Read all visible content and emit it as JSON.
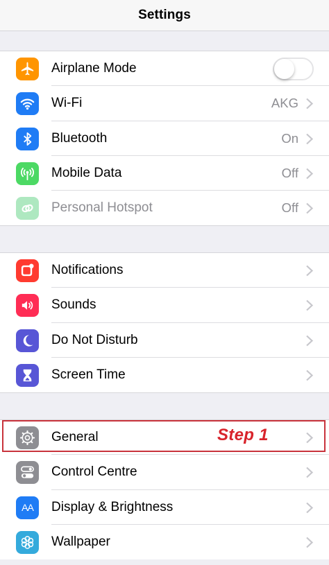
{
  "nav": {
    "title": "Settings"
  },
  "colors": {
    "orange": "#ff9500",
    "blue": "#1f7cf5",
    "green": "#4cd964",
    "green_light": "#aee8c0",
    "red": "#ff3b30",
    "pink": "#ff2d55",
    "purple": "#5856d6",
    "gray": "#8e8e93",
    "annotation": "#d8242c"
  },
  "group1": [
    {
      "label": "Airplane Mode",
      "icon": "airplane-icon",
      "toggle": "off"
    },
    {
      "label": "Wi-Fi",
      "icon": "wifi-icon",
      "value": "AKG"
    },
    {
      "label": "Bluetooth",
      "icon": "bluetooth-icon",
      "value": "On"
    },
    {
      "label": "Mobile Data",
      "icon": "antenna-icon",
      "value": "Off"
    },
    {
      "label": "Personal Hotspot",
      "icon": "hotspot-link-icon",
      "value": "Off",
      "disabled": true
    }
  ],
  "group2": [
    {
      "label": "Notifications",
      "icon": "notifications-icon"
    },
    {
      "label": "Sounds",
      "icon": "speaker-icon"
    },
    {
      "label": "Do Not Disturb",
      "icon": "moon-icon"
    },
    {
      "label": "Screen Time",
      "icon": "hourglass-icon"
    }
  ],
  "group3": [
    {
      "label": "General",
      "icon": "gear-icon"
    },
    {
      "label": "Control Centre",
      "icon": "toggles-icon"
    },
    {
      "label": "Display & Brightness",
      "icon": "text-size-icon",
      "icon_text": "AA"
    },
    {
      "label": "Wallpaper",
      "icon": "flower-icon"
    }
  ],
  "annotation": {
    "text": "Step 1"
  }
}
